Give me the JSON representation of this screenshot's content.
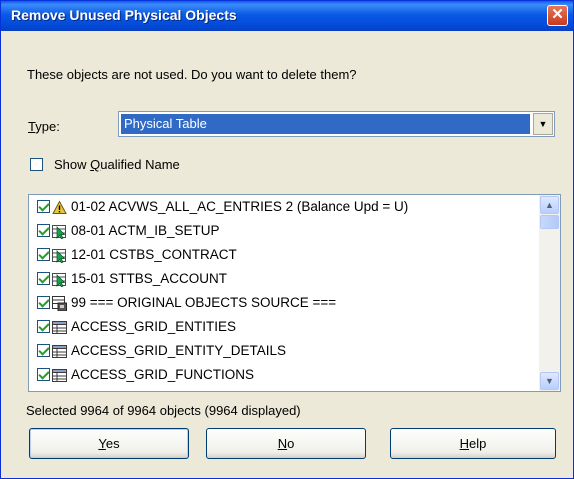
{
  "dialog": {
    "title": "Remove Unused Physical Objects",
    "close_label": "✕",
    "prompt": "These objects are not used. Do you want to delete them?",
    "type_label_accel": "T",
    "type_label_rest": "ype:",
    "type_value": "Physical Table",
    "show_qualified_pre": "Show ",
    "show_qualified_accel": "Q",
    "show_qualified_rest": "ualified Name",
    "show_qualified_checked": false,
    "items": [
      {
        "icon": "warning-icon",
        "label": "01-02  ACVWS_ALL_AC_ENTRIES 2 (Balance Upd = U)",
        "checked": true
      },
      {
        "icon": "green-cursor-table-icon",
        "label": "08-01  ACTM_IB_SETUP",
        "checked": true
      },
      {
        "icon": "green-cursor-table-icon",
        "label": "12-01  CSTBS_CONTRACT",
        "checked": true
      },
      {
        "icon": "green-cursor-table-icon",
        "label": "15-01  STTBS_ACCOUNT",
        "checked": true
      },
      {
        "icon": "stored-source-icon",
        "label": "99  ===  ORIGINAL OBJECTS SOURCE  ===",
        "checked": true
      },
      {
        "icon": "table-icon",
        "label": "ACCESS_GRID_ENTITIES",
        "checked": true
      },
      {
        "icon": "table-icon",
        "label": "ACCESS_GRID_ENTITY_DETAILS",
        "checked": true
      },
      {
        "icon": "table-icon",
        "label": "ACCESS_GRID_FUNCTIONS",
        "checked": true
      }
    ],
    "status": "Selected 9964 of 9964 objects (9964 displayed)",
    "yes_accel": "Y",
    "yes_rest": "es",
    "no_accel": "N",
    "no_rest": "o",
    "help_accel": "H",
    "help_rest": "elp"
  }
}
